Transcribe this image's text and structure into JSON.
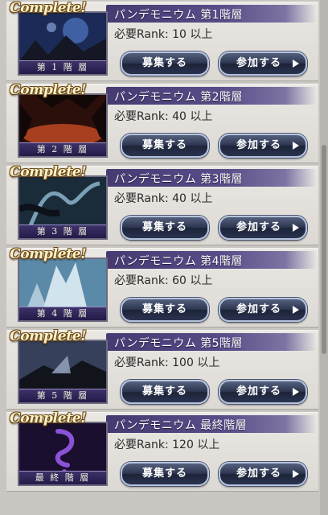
{
  "status_badge": "Complete!",
  "buttons": {
    "recruit": "募集する",
    "join": "参加する"
  },
  "quests": [
    {
      "title": "パンデモニウム 第1階層",
      "rank": "必要Rank: 10 以上",
      "floor_label": "第 1 階 層",
      "theme": {
        "sky": "#1b2a56",
        "accent": "#4f79c4",
        "ground": "#151724"
      }
    },
    {
      "title": "パンデモニウム 第2階層",
      "rank": "必要Rank: 40 以上",
      "floor_label": "第 2 階 層",
      "theme": {
        "sky": "#2a0f0b",
        "accent": "#c74a22",
        "ground": "#120807"
      }
    },
    {
      "title": "パンデモニウム 第3階層",
      "rank": "必要Rank: 40 以上",
      "floor_label": "第 3 階 層",
      "theme": {
        "sky": "#1a2b3a",
        "accent": "#7aa0b5",
        "ground": "#0c1218"
      }
    },
    {
      "title": "パンデモニウム 第4階層",
      "rank": "必要Rank: 60 以上",
      "floor_label": "第 4 階 層",
      "theme": {
        "sky": "#5a8aa8",
        "accent": "#e6f2f8",
        "ground": "#24394a"
      }
    },
    {
      "title": "パンデモニウム 第5階層",
      "rank": "必要Rank: 100 以上",
      "floor_label": "第 5 階 層",
      "theme": {
        "sky": "#36405a",
        "accent": "#9aa8c2",
        "ground": "#12141c"
      }
    },
    {
      "title": "パンデモニウム 最終階層",
      "rank": "必要Rank: 120 以上",
      "floor_label": "最 終 階 層",
      "theme": {
        "sky": "#1a0f2e",
        "accent": "#8a52d6",
        "ground": "#0b0714"
      }
    }
  ]
}
